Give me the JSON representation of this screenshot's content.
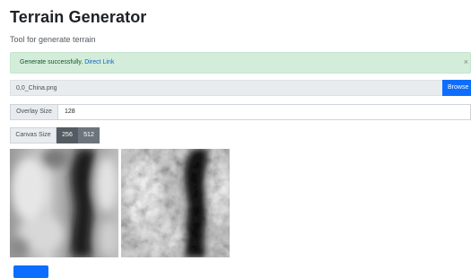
{
  "header": {
    "title": "Terrain Generator",
    "subtitle": "Tool for generate terrain"
  },
  "alert": {
    "message": "Generate successfully.",
    "link_text": "Direct Link",
    "close_symbol": "×",
    "bg_color": "#d4edda"
  },
  "file_input": {
    "file_name": "0,0_China.png",
    "browse_label": "Browse"
  },
  "overlay": {
    "label": "Overlay Size",
    "value": "128"
  },
  "canvas": {
    "label": "Canvas Size",
    "options": [
      "256",
      "512"
    ],
    "selected": "256"
  },
  "previews": [
    {
      "name": "heightmap-preview",
      "icon": "grayscale-heightmap"
    },
    {
      "name": "relief-preview",
      "icon": "shaded-relief-map"
    }
  ],
  "accent_color": "#0d6efd"
}
